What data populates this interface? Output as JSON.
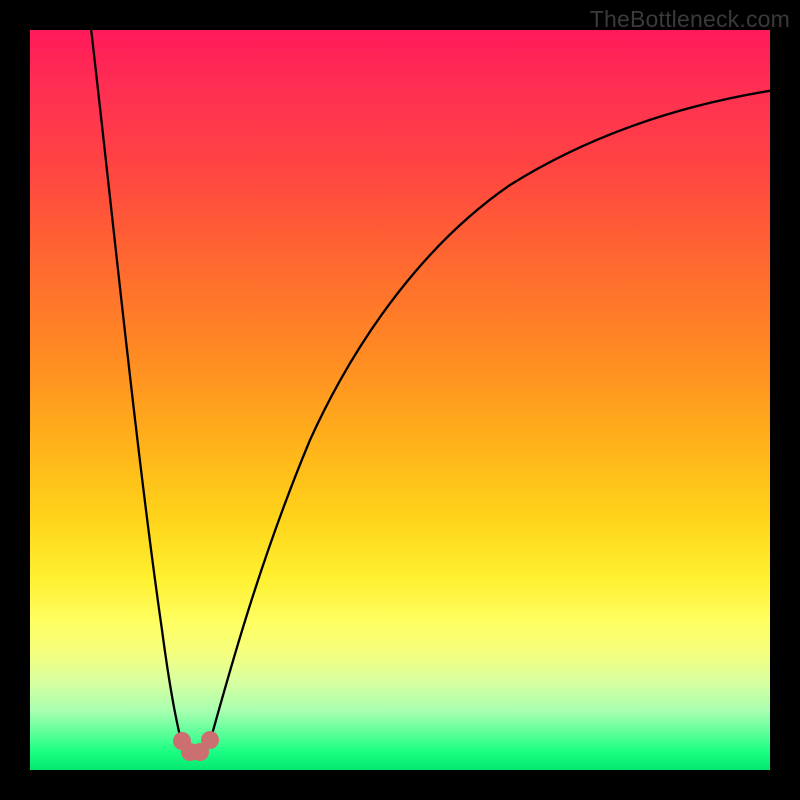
{
  "watermark": "TheBottleneck.com",
  "chart_data": {
    "type": "line",
    "title": "",
    "xlabel": "",
    "ylabel": "",
    "xlim": [
      0,
      100
    ],
    "ylim": [
      0,
      100
    ],
    "grid": false,
    "background_gradient": {
      "direction": "top-to-bottom",
      "stops": [
        {
          "pos": 0,
          "color": "#ff1a5a"
        },
        {
          "pos": 18,
          "color": "#ff4343"
        },
        {
          "pos": 45,
          "color": "#ff8e22"
        },
        {
          "pos": 66,
          "color": "#ffd41a"
        },
        {
          "pos": 80,
          "color": "#ffff62"
        },
        {
          "pos": 92,
          "color": "#a8ffb0"
        },
        {
          "pos": 100,
          "color": "#04e86f"
        }
      ]
    },
    "series": [
      {
        "name": "bottleneck-curve",
        "color": "#000000",
        "x": [
          0,
          5,
          10,
          14,
          17,
          19,
          20.5,
          22,
          24,
          27,
          31,
          36,
          42,
          50,
          58,
          66,
          74,
          82,
          90,
          100
        ],
        "y": [
          100,
          72,
          44,
          22,
          8,
          2,
          1,
          2,
          8,
          20,
          35,
          48,
          59,
          70,
          77,
          82,
          86,
          89,
          91,
          93
        ]
      }
    ],
    "markers": [
      {
        "name": "trough-point-left",
        "x": 19,
        "y": 2,
        "color": "#cc6f70",
        "r": 1.5
      },
      {
        "name": "trough-point-mid",
        "x": 20.5,
        "y": 1,
        "color": "#cc6f70",
        "r": 1.5
      },
      {
        "name": "trough-point-right",
        "x": 22,
        "y": 2,
        "color": "#cc6f70",
        "r": 1.5
      }
    ]
  }
}
